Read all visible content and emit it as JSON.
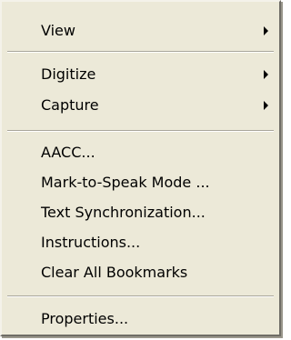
{
  "context_menu": {
    "items": [
      {
        "label": "View",
        "has_submenu": true
      },
      {
        "label": "Digitize",
        "has_submenu": true
      },
      {
        "label": "Capture",
        "has_submenu": true
      },
      {
        "label": "AACC...",
        "has_submenu": false
      },
      {
        "label": "Mark-to-Speak Mode ...",
        "has_submenu": false
      },
      {
        "label": "Text Synchronization...",
        "has_submenu": false
      },
      {
        "label": "Instructions...",
        "has_submenu": false
      },
      {
        "label": "Clear All Bookmarks",
        "has_submenu": false
      },
      {
        "label": "Properties...",
        "has_submenu": false
      }
    ],
    "submenu_arrow_icon": "chevron-right-icon"
  }
}
